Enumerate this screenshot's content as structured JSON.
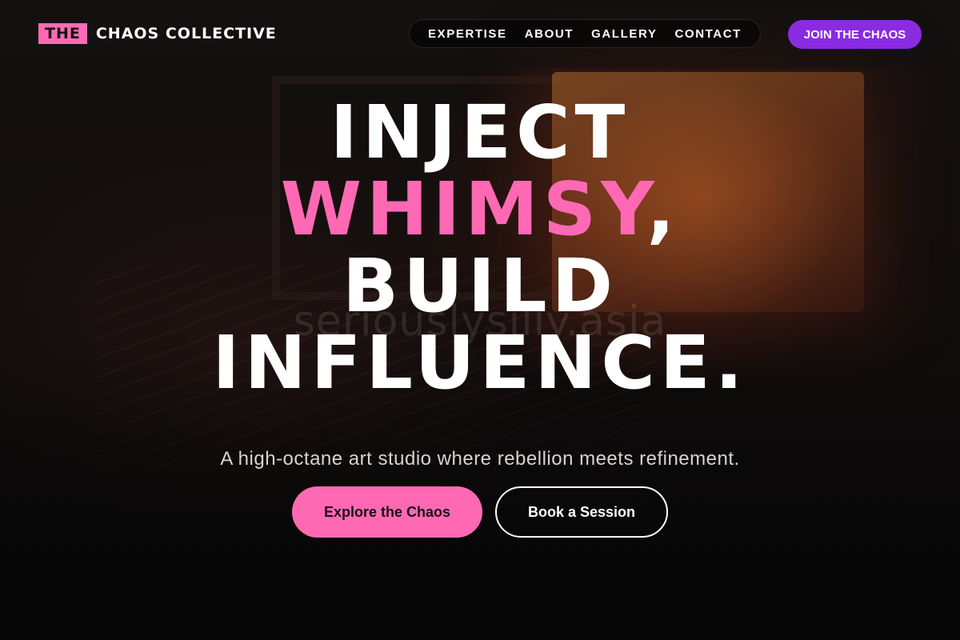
{
  "brand": {
    "badge": "THE",
    "name": "CHAOS COLLECTIVE",
    "accent_color": "#ff69b4"
  },
  "nav": {
    "items": [
      {
        "label": "EXPERTISE"
      },
      {
        "label": "ABOUT"
      },
      {
        "label": "GALLERY"
      },
      {
        "label": "CONTACT"
      }
    ]
  },
  "header": {
    "cta_label": "JOIN THE CHAOS",
    "cta_color": "#8a2be2"
  },
  "hero": {
    "line1": "INJECT",
    "line2_accent": "WHIMSY",
    "line2_punct": ",",
    "line3": "BUILD",
    "line4": "INFLUENCE.",
    "subtitle": "A high-octane art studio where rebellion meets refinement.",
    "primary_cta": "Explore the Chaos",
    "secondary_cta": "Book a Session"
  },
  "background": {
    "watermark": "seriouslysilly.asia"
  }
}
